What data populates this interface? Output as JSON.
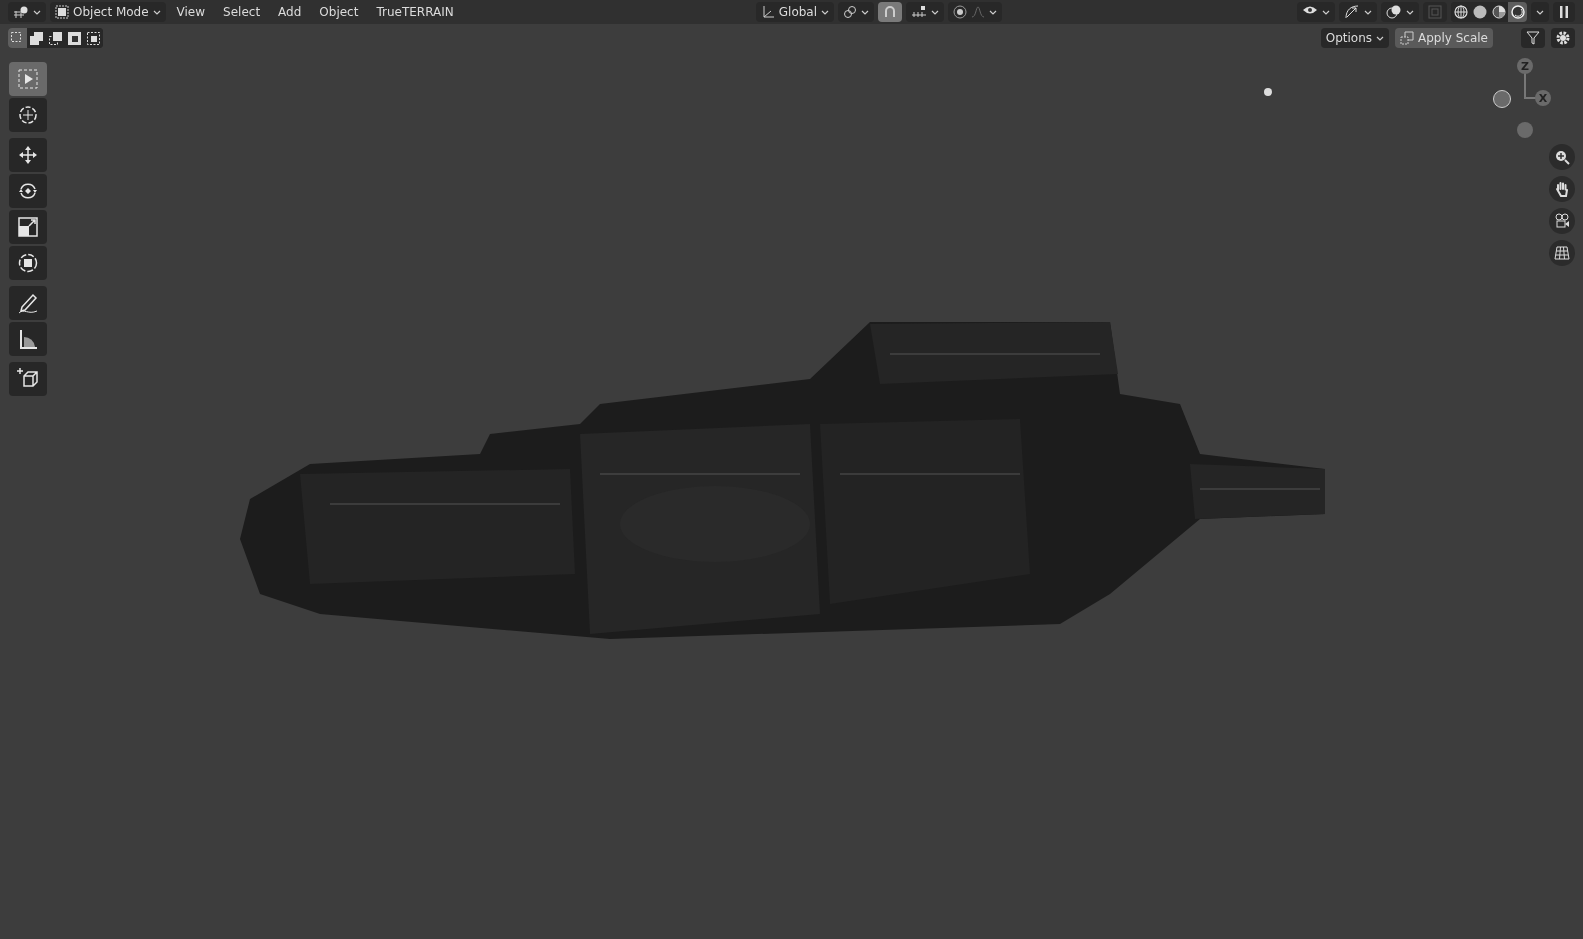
{
  "header": {
    "mode": {
      "label": "Object Mode"
    },
    "menus": [
      "View",
      "Select",
      "Add",
      "Object",
      "TrueTERRAIN"
    ],
    "orientation": {
      "label": "Global"
    },
    "snap": {
      "on": true
    },
    "proportional": {
      "on": false
    },
    "shading_modes": [
      {
        "kind": "wireframe",
        "selected": false
      },
      {
        "kind": "solid",
        "selected": false
      },
      {
        "kind": "material",
        "selected": false
      },
      {
        "kind": "rendered",
        "selected": true
      }
    ]
  },
  "tool_settings": {
    "select_modes": [
      {
        "kind": "new",
        "selected": true
      },
      {
        "kind": "extend",
        "selected": false
      },
      {
        "kind": "subtract",
        "selected": false
      },
      {
        "kind": "invert",
        "selected": false
      },
      {
        "kind": "intersect",
        "selected": false
      }
    ],
    "options": "Options",
    "apply_scale": "Apply Scale"
  },
  "toolbar": [
    {
      "kind": "select",
      "selected": true
    },
    {
      "kind": "cursor",
      "selected": false
    },
    {
      "kind": "move",
      "selected": false
    },
    {
      "kind": "rotate",
      "selected": false
    },
    {
      "kind": "scale",
      "selected": false
    },
    {
      "kind": "transform",
      "selected": false
    },
    {
      "kind": "annotate",
      "selected": false
    },
    {
      "kind": "measure",
      "selected": false
    },
    {
      "kind": "add-cube",
      "selected": false
    }
  ],
  "gizmo": {
    "axes": [
      {
        "label": "Z"
      },
      {
        "label": "X"
      }
    ]
  }
}
